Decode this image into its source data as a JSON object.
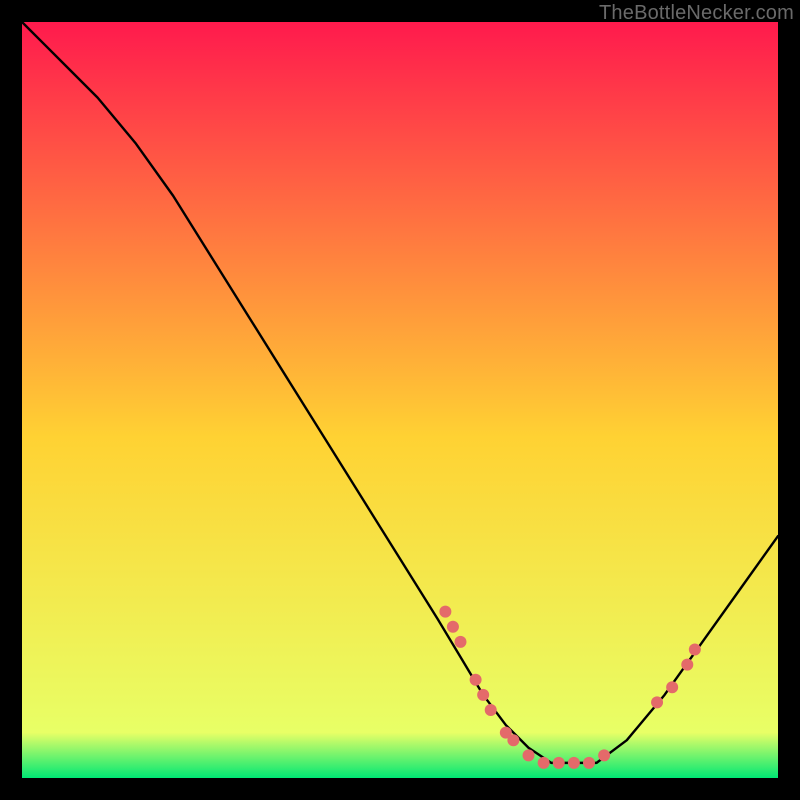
{
  "watermark": "TheBottleNecker.com",
  "chart_data": {
    "type": "line",
    "title": "",
    "xlabel": "",
    "ylabel": "",
    "xlim": [
      0,
      100
    ],
    "ylim": [
      0,
      100
    ],
    "grid": false,
    "legend": false,
    "background_gradient": [
      "#ff1a4d",
      "#ffd233",
      "#00e874"
    ],
    "series": [
      {
        "name": "curve",
        "x": [
          0,
          3,
          6,
          10,
          15,
          20,
          25,
          30,
          35,
          40,
          45,
          50,
          55,
          58,
          61,
          64,
          67,
          70,
          73,
          76,
          80,
          85,
          90,
          95,
          100
        ],
        "y": [
          100,
          97,
          94,
          90,
          84,
          77,
          69,
          61,
          53,
          45,
          37,
          29,
          21,
          16,
          11,
          7,
          4,
          2,
          2,
          2,
          5,
          11,
          18,
          25,
          32
        ]
      }
    ],
    "markers": [
      {
        "name": "left-cluster-top",
        "x": 56,
        "y": 22
      },
      {
        "name": "left-cluster-a",
        "x": 57,
        "y": 20
      },
      {
        "name": "left-cluster-b",
        "x": 58,
        "y": 18
      },
      {
        "name": "left-cluster-c",
        "x": 60,
        "y": 13
      },
      {
        "name": "left-cluster-d",
        "x": 61,
        "y": 11
      },
      {
        "name": "left-cluster-e",
        "x": 62,
        "y": 9
      },
      {
        "name": "bottom-a",
        "x": 64,
        "y": 6
      },
      {
        "name": "bottom-b",
        "x": 65,
        "y": 5
      },
      {
        "name": "bottom-c",
        "x": 67,
        "y": 3
      },
      {
        "name": "bottom-d",
        "x": 69,
        "y": 2
      },
      {
        "name": "bottom-e",
        "x": 71,
        "y": 2
      },
      {
        "name": "bottom-f",
        "x": 73,
        "y": 2
      },
      {
        "name": "bottom-g",
        "x": 75,
        "y": 2
      },
      {
        "name": "bottom-h",
        "x": 77,
        "y": 3
      },
      {
        "name": "right-a",
        "x": 84,
        "y": 10
      },
      {
        "name": "right-b",
        "x": 86,
        "y": 12
      },
      {
        "name": "right-c",
        "x": 88,
        "y": 15
      },
      {
        "name": "right-d",
        "x": 89,
        "y": 17
      }
    ],
    "marker_style": {
      "color": "#e46a6a",
      "radius": 6
    }
  }
}
